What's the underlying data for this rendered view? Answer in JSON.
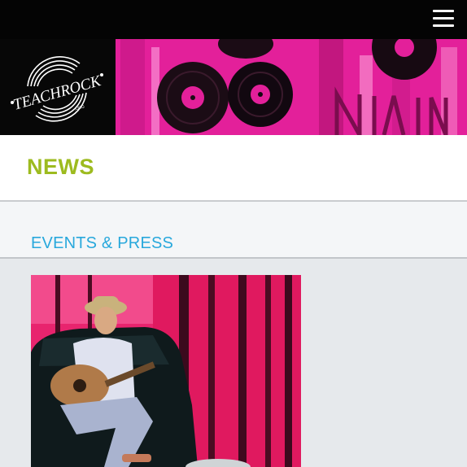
{
  "header": {
    "menu_icon": "hamburger-icon",
    "logo_text": "TEACHROCK",
    "logo_suffix": ".ORG",
    "colors": {
      "bar": "#040404",
      "banner_accent": "#e3209a"
    }
  },
  "page": {
    "title": "NEWS",
    "title_color": "#9dbb1f"
  },
  "section": {
    "title": "EVENTS & PRESS",
    "title_color": "#28a8dc"
  },
  "article": {
    "image_description_icon": "article-photo"
  }
}
